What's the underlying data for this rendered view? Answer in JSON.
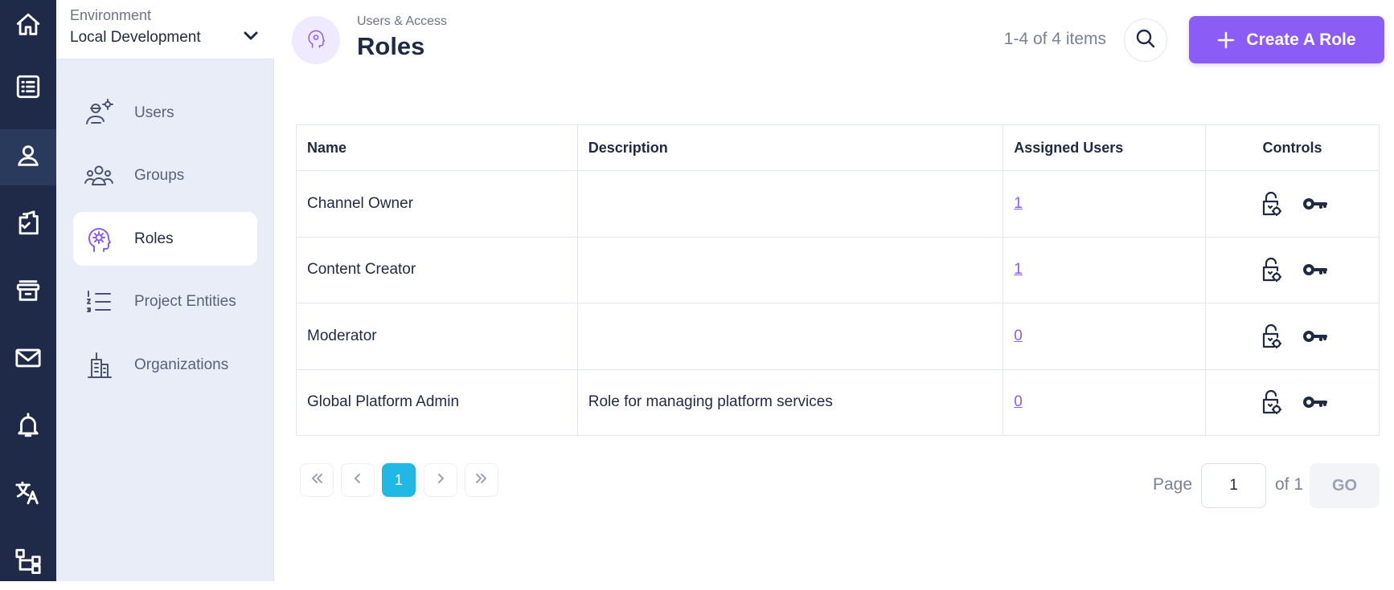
{
  "rail": {
    "items": [
      {
        "name": "home-icon"
      },
      {
        "name": "list-icon"
      },
      {
        "name": "user-icon"
      },
      {
        "name": "clipboard-check-icon"
      },
      {
        "name": "archive-icon"
      },
      {
        "name": "mail-icon"
      },
      {
        "name": "bell-icon"
      },
      {
        "name": "translate-icon"
      },
      {
        "name": "hierarchy-icon"
      }
    ]
  },
  "environment": {
    "label": "Environment",
    "value": "Local Development"
  },
  "sidebar": {
    "items": [
      {
        "label": "Users",
        "icon": "user-gear-icon"
      },
      {
        "label": "Groups",
        "icon": "group-icon"
      },
      {
        "label": "Roles",
        "icon": "head-gear-icon"
      },
      {
        "label": "Project Entities",
        "icon": "numbered-list-icon"
      },
      {
        "label": "Organizations",
        "icon": "building-icon"
      }
    ],
    "active": "Roles"
  },
  "header": {
    "breadcrumb": "Users & Access",
    "title": "Roles",
    "count": "1-4 of 4 items",
    "create_label": "Create A Role"
  },
  "table": {
    "headers": {
      "name": "Name",
      "description": "Description",
      "assigned": "Assigned Users",
      "controls": "Controls"
    },
    "rows": [
      {
        "name": "Channel Owner",
        "description": "",
        "assigned": "1"
      },
      {
        "name": "Content Creator",
        "description": "",
        "assigned": "1"
      },
      {
        "name": "Moderator",
        "description": "",
        "assigned": "0"
      },
      {
        "name": "Global Platform Admin",
        "description": "Role for managing platform services",
        "assigned": "0"
      }
    ]
  },
  "pagination": {
    "current": "1",
    "page_label": "Page",
    "page_value": "1",
    "of_label": "of 1",
    "go_label": "GO"
  },
  "colors": {
    "accent": "#8b5cf6",
    "rail_bg": "#1e2a47",
    "sidebar_bg": "#e9edf7",
    "page_active": "#22b8e6"
  }
}
